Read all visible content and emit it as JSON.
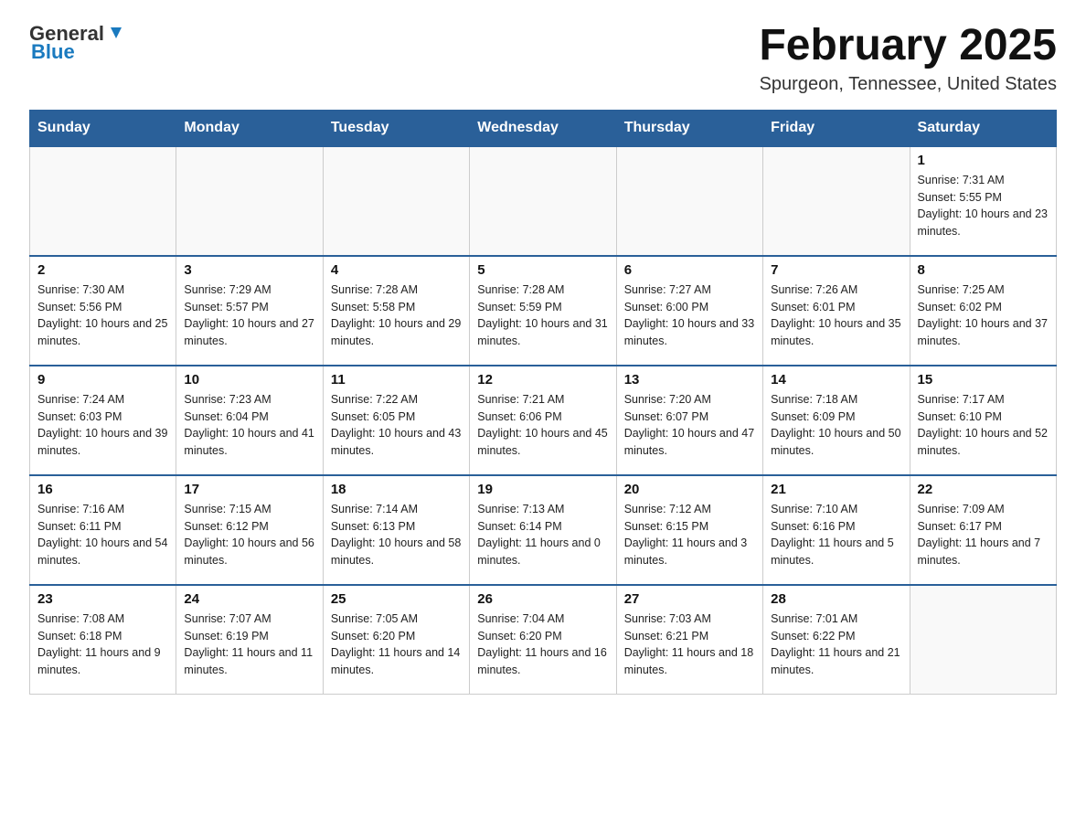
{
  "header": {
    "logo": {
      "general": "General",
      "blue": "Blue"
    },
    "title": "February 2025",
    "location": "Spurgeon, Tennessee, United States"
  },
  "days_of_week": [
    "Sunday",
    "Monday",
    "Tuesday",
    "Wednesday",
    "Thursday",
    "Friday",
    "Saturday"
  ],
  "weeks": [
    [
      {
        "day": "",
        "info": ""
      },
      {
        "day": "",
        "info": ""
      },
      {
        "day": "",
        "info": ""
      },
      {
        "day": "",
        "info": ""
      },
      {
        "day": "",
        "info": ""
      },
      {
        "day": "",
        "info": ""
      },
      {
        "day": "1",
        "info": "Sunrise: 7:31 AM\nSunset: 5:55 PM\nDaylight: 10 hours and 23 minutes."
      }
    ],
    [
      {
        "day": "2",
        "info": "Sunrise: 7:30 AM\nSunset: 5:56 PM\nDaylight: 10 hours and 25 minutes."
      },
      {
        "day": "3",
        "info": "Sunrise: 7:29 AM\nSunset: 5:57 PM\nDaylight: 10 hours and 27 minutes."
      },
      {
        "day": "4",
        "info": "Sunrise: 7:28 AM\nSunset: 5:58 PM\nDaylight: 10 hours and 29 minutes."
      },
      {
        "day": "5",
        "info": "Sunrise: 7:28 AM\nSunset: 5:59 PM\nDaylight: 10 hours and 31 minutes."
      },
      {
        "day": "6",
        "info": "Sunrise: 7:27 AM\nSunset: 6:00 PM\nDaylight: 10 hours and 33 minutes."
      },
      {
        "day": "7",
        "info": "Sunrise: 7:26 AM\nSunset: 6:01 PM\nDaylight: 10 hours and 35 minutes."
      },
      {
        "day": "8",
        "info": "Sunrise: 7:25 AM\nSunset: 6:02 PM\nDaylight: 10 hours and 37 minutes."
      }
    ],
    [
      {
        "day": "9",
        "info": "Sunrise: 7:24 AM\nSunset: 6:03 PM\nDaylight: 10 hours and 39 minutes."
      },
      {
        "day": "10",
        "info": "Sunrise: 7:23 AM\nSunset: 6:04 PM\nDaylight: 10 hours and 41 minutes."
      },
      {
        "day": "11",
        "info": "Sunrise: 7:22 AM\nSunset: 6:05 PM\nDaylight: 10 hours and 43 minutes."
      },
      {
        "day": "12",
        "info": "Sunrise: 7:21 AM\nSunset: 6:06 PM\nDaylight: 10 hours and 45 minutes."
      },
      {
        "day": "13",
        "info": "Sunrise: 7:20 AM\nSunset: 6:07 PM\nDaylight: 10 hours and 47 minutes."
      },
      {
        "day": "14",
        "info": "Sunrise: 7:18 AM\nSunset: 6:09 PM\nDaylight: 10 hours and 50 minutes."
      },
      {
        "day": "15",
        "info": "Sunrise: 7:17 AM\nSunset: 6:10 PM\nDaylight: 10 hours and 52 minutes."
      }
    ],
    [
      {
        "day": "16",
        "info": "Sunrise: 7:16 AM\nSunset: 6:11 PM\nDaylight: 10 hours and 54 minutes."
      },
      {
        "day": "17",
        "info": "Sunrise: 7:15 AM\nSunset: 6:12 PM\nDaylight: 10 hours and 56 minutes."
      },
      {
        "day": "18",
        "info": "Sunrise: 7:14 AM\nSunset: 6:13 PM\nDaylight: 10 hours and 58 minutes."
      },
      {
        "day": "19",
        "info": "Sunrise: 7:13 AM\nSunset: 6:14 PM\nDaylight: 11 hours and 0 minutes."
      },
      {
        "day": "20",
        "info": "Sunrise: 7:12 AM\nSunset: 6:15 PM\nDaylight: 11 hours and 3 minutes."
      },
      {
        "day": "21",
        "info": "Sunrise: 7:10 AM\nSunset: 6:16 PM\nDaylight: 11 hours and 5 minutes."
      },
      {
        "day": "22",
        "info": "Sunrise: 7:09 AM\nSunset: 6:17 PM\nDaylight: 11 hours and 7 minutes."
      }
    ],
    [
      {
        "day": "23",
        "info": "Sunrise: 7:08 AM\nSunset: 6:18 PM\nDaylight: 11 hours and 9 minutes."
      },
      {
        "day": "24",
        "info": "Sunrise: 7:07 AM\nSunset: 6:19 PM\nDaylight: 11 hours and 11 minutes."
      },
      {
        "day": "25",
        "info": "Sunrise: 7:05 AM\nSunset: 6:20 PM\nDaylight: 11 hours and 14 minutes."
      },
      {
        "day": "26",
        "info": "Sunrise: 7:04 AM\nSunset: 6:20 PM\nDaylight: 11 hours and 16 minutes."
      },
      {
        "day": "27",
        "info": "Sunrise: 7:03 AM\nSunset: 6:21 PM\nDaylight: 11 hours and 18 minutes."
      },
      {
        "day": "28",
        "info": "Sunrise: 7:01 AM\nSunset: 6:22 PM\nDaylight: 11 hours and 21 minutes."
      },
      {
        "day": "",
        "info": ""
      }
    ]
  ]
}
